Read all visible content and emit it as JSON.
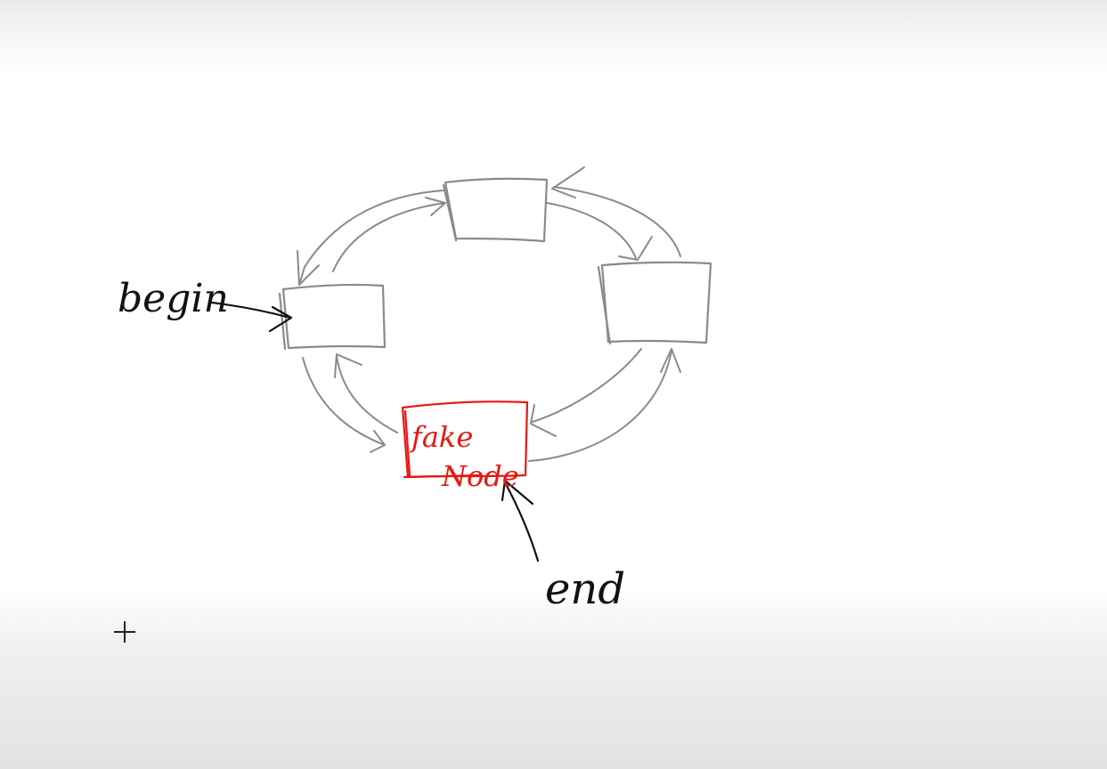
{
  "diagram": {
    "labels": {
      "begin": "begin",
      "end": "end",
      "fake_line1": "fake",
      "fake_line2": "Node"
    },
    "colors": {
      "node_stroke": "#8a8a8a",
      "fake_node": "#e8170f",
      "ink": "#111111"
    }
  }
}
